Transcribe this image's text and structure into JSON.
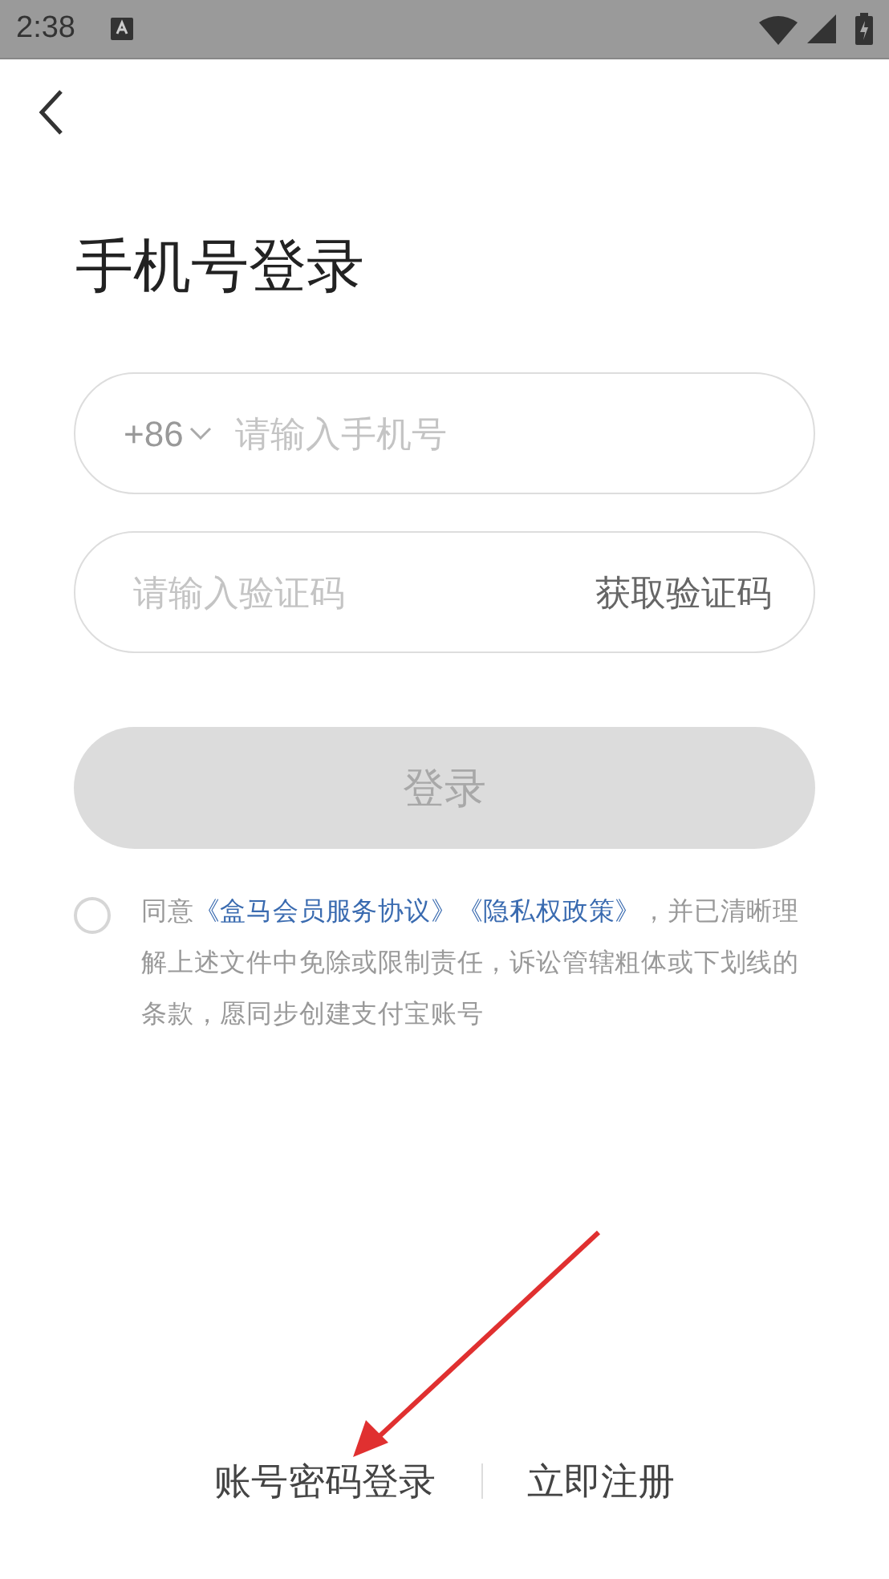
{
  "status_bar": {
    "time": "2:38"
  },
  "title": "手机号登录",
  "phone": {
    "country_code": "+86",
    "placeholder": "请输入手机号"
  },
  "code": {
    "placeholder": "请输入验证码",
    "button": "获取验证码"
  },
  "login_button": {
    "label": "登录",
    "disabled": true
  },
  "agreement": {
    "checked": false,
    "prefix": "同意",
    "links": [
      "《盒马会员服务协议》",
      "《隐私权政策》"
    ],
    "suffix": "，并已清晰理解上述文件中免除或限制责任，诉讼管辖粗体或下划线的条款，愿同步创建支付宝账号"
  },
  "footer_links": [
    "账号密码登录",
    "立即注册"
  ]
}
